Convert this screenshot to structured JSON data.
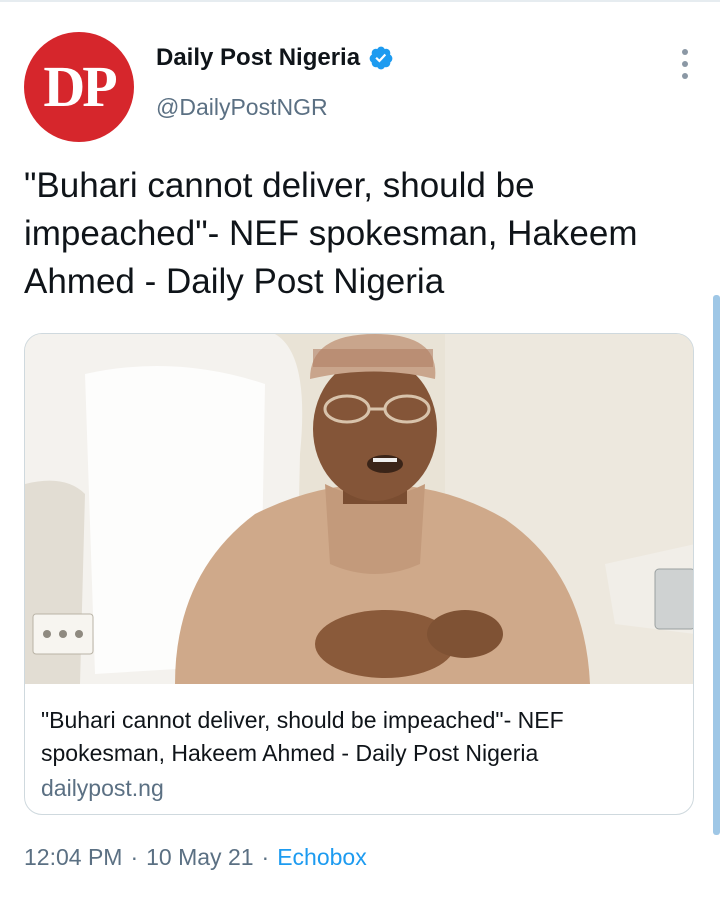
{
  "account": {
    "avatar_text": "DP",
    "name": "Daily Post Nigeria",
    "handle": "@DailyPostNGR",
    "verified": true
  },
  "tweet": {
    "text": "\"Buhari cannot deliver, should be impeached\"- NEF spokesman, Hakeem Ahmed - Daily Post Nigeria"
  },
  "card": {
    "title": "\"Buhari cannot deliver, should be impeached\"- NEF spokesman, Hakeem Ahmed - Daily Post Nigeria",
    "domain": "dailypost.ng"
  },
  "meta": {
    "time": "12:04 PM",
    "date": "10 May 21",
    "separator": "·",
    "source": "Echobox"
  },
  "colors": {
    "avatar_bg": "#d6262c",
    "verified": "#1d9bf0",
    "link": "#1d9bf0",
    "muted": "#5b7083"
  },
  "icons": {
    "verified": "verified-badge-icon",
    "more": "more-vertical-icon"
  }
}
